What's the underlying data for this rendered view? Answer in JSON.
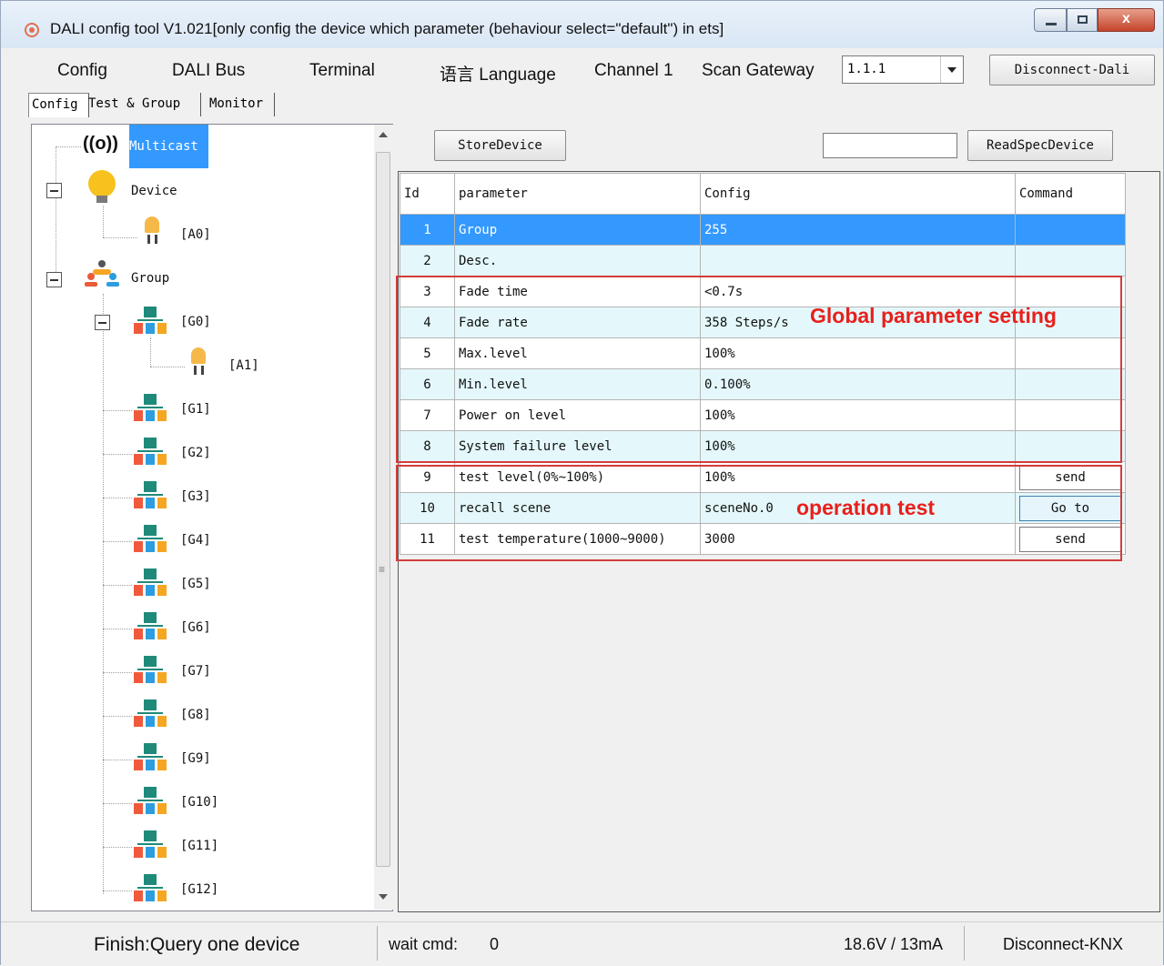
{
  "window": {
    "title": "DALI config tool V1.021[only config the device which parameter (behaviour select=\"default\") in ets]",
    "close_glyph": "x"
  },
  "menubar": {
    "items": [
      "Config",
      "DALI Bus",
      "Terminal",
      "语言 Language",
      "Channel 1",
      "Scan Gateway"
    ],
    "gateway_address": "1.1.1",
    "disconnect_dali": "Disconnect-Dali"
  },
  "tabs": [
    "Config",
    "Test & Group",
    "Monitor"
  ],
  "tree": {
    "multicast": "Multicast",
    "device": "Device",
    "device_children": [
      "[A0]"
    ],
    "group": "Group",
    "g0": "[G0]",
    "g0_children": [
      "[A1]"
    ],
    "groups": [
      "[G1]",
      "[G2]",
      "[G3]",
      "[G4]",
      "[G5]",
      "[G6]",
      "[G7]",
      "[G8]",
      "[G9]",
      "[G10]",
      "[G11]",
      "[G12]"
    ]
  },
  "toolbar": {
    "store_device": "StoreDevice",
    "read_spec_device": "ReadSpecDevice",
    "spec_input_value": ""
  },
  "grid": {
    "columns": [
      "Id",
      "parameter",
      "Config",
      "Command"
    ],
    "rows": [
      {
        "id": "1",
        "parameter": "Group",
        "config": "255",
        "command": ""
      },
      {
        "id": "2",
        "parameter": "Desc.",
        "config": "",
        "command": ""
      },
      {
        "id": "3",
        "parameter": "Fade time",
        "config": "<0.7s",
        "command": ""
      },
      {
        "id": "4",
        "parameter": "Fade rate",
        "config": "358 Steps/s",
        "command": ""
      },
      {
        "id": "5",
        "parameter": "Max.level",
        "config": "100%",
        "command": ""
      },
      {
        "id": "6",
        "parameter": "Min.level",
        "config": "0.100%",
        "command": ""
      },
      {
        "id": "7",
        "parameter": "Power on level",
        "config": "100%",
        "command": ""
      },
      {
        "id": "8",
        "parameter": "System failure level",
        "config": "100%",
        "command": ""
      },
      {
        "id": "9",
        "parameter": "test level(0%~100%)",
        "config": "100%",
        "command": "send"
      },
      {
        "id": "10",
        "parameter": "recall scene",
        "config": "sceneNo.0",
        "command": "Go to"
      },
      {
        "id": "11",
        "parameter": "test temperature(1000~9000)",
        "config": "3000",
        "command": "send"
      }
    ]
  },
  "annotations": {
    "global": "Global parameter setting",
    "operation": "operation test",
    "color": "#e8201c"
  },
  "statusbar": {
    "message": "Finish:Query one device",
    "wait_label": "wait cmd:",
    "wait_value": "0",
    "power": "18.6V / 13mA",
    "disconnect_knx": "Disconnect-KNX"
  },
  "colors": {
    "selection": "#3399ff",
    "alt_row": "#e4f8fb",
    "titlebar": "#dbe8f5"
  }
}
